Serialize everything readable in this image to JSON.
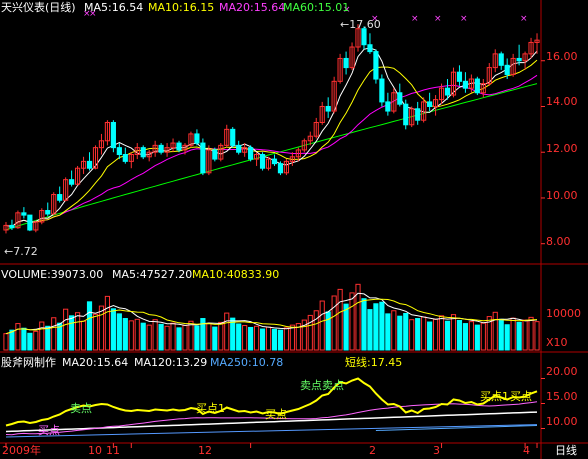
{
  "header": {
    "stock": "天兴仪表(日线)",
    "ma5": "MA5:16.54",
    "ma10": "MA10:16.15",
    "ma20": "MA20:15.64",
    "ma60": "MA60:15.01"
  },
  "annotations": {
    "high": "17.60",
    "low": "7.72"
  },
  "volume_header": {
    "volume": "VOLUME:39073.00",
    "ma5": "MA5:47527.20",
    "ma10": "MA10:40833.90"
  },
  "indicator_header": {
    "source": "股斧网制作",
    "ma20": "MA20:15.64",
    "ma120": "MA120:13.29",
    "ma250": "MA250:10.78",
    "short_line": "短线:17.45"
  },
  "signals": {
    "sell_1": "卖点",
    "buy_1": "买点1",
    "buy_2": "买点",
    "buy_3": "买点",
    "sell_2": "卖点卖点",
    "buy_4": "买点1",
    "buy_5": "买点"
  },
  "price_axis": [
    "16.00",
    "14.00",
    "12.00",
    "10.00",
    "8.00"
  ],
  "volume_axis": [
    "10000",
    "X10"
  ],
  "indicator_axis": [
    "20.00",
    "15.00",
    "10.00"
  ],
  "time_axis": [
    "2009年",
    "10",
    "11",
    "12",
    "2",
    "3",
    "4"
  ],
  "period": "日线",
  "colors": {
    "up": "#ff3030",
    "down": "#00ffff",
    "ma5": "#ffffff",
    "ma10": "#ffff00",
    "ma20": "#ff00ff",
    "ma60": "#00ff00",
    "axis": "#b00000"
  },
  "chart_data": {
    "type": "candlestick",
    "price_range": [
      7.2,
      18.0
    ],
    "high_marker": 17.6,
    "low_marker": 7.72,
    "ohlc": [
      [
        8.6,
        8.95,
        8.45,
        8.8
      ],
      [
        8.8,
        9.05,
        8.6,
        8.7
      ],
      [
        8.7,
        9.45,
        8.65,
        9.35
      ],
      [
        9.35,
        9.6,
        9.1,
        9.25
      ],
      [
        9.25,
        9.25,
        8.55,
        8.6
      ],
      [
        8.6,
        9.0,
        8.5,
        8.95
      ],
      [
        8.95,
        9.55,
        8.85,
        9.45
      ],
      [
        9.45,
        9.8,
        9.2,
        9.3
      ],
      [
        9.3,
        10.25,
        9.25,
        10.15
      ],
      [
        10.15,
        10.5,
        9.8,
        9.9
      ],
      [
        9.9,
        10.9,
        9.85,
        10.8
      ],
      [
        10.8,
        11.2,
        10.5,
        10.6
      ],
      [
        10.6,
        11.4,
        10.55,
        11.3
      ],
      [
        11.3,
        11.8,
        11.05,
        11.6
      ],
      [
        11.6,
        12.0,
        11.2,
        11.3
      ],
      [
        11.3,
        12.3,
        11.25,
        12.2
      ],
      [
        12.2,
        12.8,
        11.9,
        12.5
      ],
      [
        12.5,
        13.4,
        12.3,
        13.3
      ],
      [
        13.3,
        13.4,
        12.0,
        12.2
      ],
      [
        12.2,
        12.4,
        11.7,
        11.9
      ],
      [
        11.9,
        12.2,
        11.5,
        11.6
      ],
      [
        11.6,
        12.0,
        11.3,
        11.9
      ],
      [
        11.9,
        12.4,
        11.7,
        12.2
      ],
      [
        12.2,
        12.3,
        11.7,
        11.8
      ],
      [
        11.8,
        12.1,
        11.6,
        12.0
      ],
      [
        12.0,
        12.5,
        11.8,
        12.3
      ],
      [
        12.3,
        12.4,
        11.9,
        12.0
      ],
      [
        12.0,
        12.4,
        11.8,
        12.2
      ],
      [
        12.2,
        12.6,
        12.0,
        12.4
      ],
      [
        12.4,
        12.5,
        12.0,
        12.1
      ],
      [
        12.1,
        12.4,
        11.9,
        12.3
      ],
      [
        12.3,
        12.9,
        12.2,
        12.8
      ],
      [
        12.8,
        13.0,
        12.3,
        12.4
      ],
      [
        12.4,
        12.6,
        11.0,
        11.1
      ],
      [
        11.1,
        12.3,
        11.0,
        12.1
      ],
      [
        12.1,
        12.2,
        11.6,
        11.7
      ],
      [
        11.7,
        12.4,
        11.6,
        12.3
      ],
      [
        12.3,
        13.2,
        12.2,
        13.0
      ],
      [
        13.0,
        13.1,
        12.2,
        12.3
      ],
      [
        12.3,
        12.5,
        11.9,
        12.0
      ],
      [
        12.0,
        12.4,
        11.8,
        12.2
      ],
      [
        12.2,
        12.3,
        11.6,
        11.7
      ],
      [
        11.7,
        12.0,
        11.4,
        11.9
      ],
      [
        11.9,
        12.0,
        11.2,
        11.3
      ],
      [
        11.3,
        11.8,
        11.2,
        11.7
      ],
      [
        11.7,
        11.9,
        11.4,
        11.5
      ],
      [
        11.5,
        11.6,
        11.0,
        11.1
      ],
      [
        11.1,
        11.7,
        11.0,
        11.6
      ],
      [
        11.6,
        12.0,
        11.4,
        11.8
      ],
      [
        11.8,
        12.2,
        11.6,
        12.1
      ],
      [
        12.1,
        12.6,
        12.0,
        12.5
      ],
      [
        12.5,
        12.9,
        12.3,
        12.7
      ],
      [
        12.7,
        13.5,
        12.6,
        13.3
      ],
      [
        13.3,
        14.2,
        13.2,
        14.0
      ],
      [
        14.0,
        14.4,
        13.5,
        13.8
      ],
      [
        13.8,
        15.3,
        13.7,
        15.1
      ],
      [
        15.1,
        16.3,
        15.0,
        16.1
      ],
      [
        16.1,
        16.4,
        15.4,
        15.7
      ],
      [
        15.7,
        16.8,
        15.6,
        16.6
      ],
      [
        16.6,
        17.6,
        16.4,
        17.4
      ],
      [
        17.4,
        17.5,
        16.5,
        16.7
      ],
      [
        16.7,
        17.2,
        16.3,
        16.4
      ],
      [
        16.4,
        16.5,
        15.0,
        15.2
      ],
      [
        15.2,
        15.4,
        14.0,
        14.2
      ],
      [
        14.2,
        14.6,
        13.6,
        13.8
      ],
      [
        13.8,
        14.8,
        13.7,
        14.6
      ],
      [
        14.6,
        15.0,
        14.0,
        14.1
      ],
      [
        14.1,
        14.3,
        13.0,
        13.2
      ],
      [
        13.2,
        14.0,
        13.1,
        13.9
      ],
      [
        13.9,
        14.2,
        13.2,
        13.4
      ],
      [
        13.4,
        14.4,
        13.3,
        14.2
      ],
      [
        14.2,
        14.6,
        13.8,
        14.0
      ],
      [
        14.0,
        14.5,
        13.6,
        14.3
      ],
      [
        14.3,
        15.0,
        14.1,
        14.8
      ],
      [
        14.8,
        15.2,
        14.3,
        14.5
      ],
      [
        14.5,
        15.7,
        14.4,
        15.5
      ],
      [
        15.5,
        15.8,
        14.9,
        15.1
      ],
      [
        15.1,
        15.5,
        14.6,
        14.8
      ],
      [
        14.8,
        15.4,
        14.6,
        15.2
      ],
      [
        15.2,
        15.3,
        14.5,
        14.6
      ],
      [
        14.6,
        15.2,
        14.4,
        15.0
      ],
      [
        15.0,
        15.9,
        14.9,
        15.7
      ],
      [
        15.7,
        16.5,
        15.5,
        16.3
      ],
      [
        16.3,
        16.4,
        15.6,
        15.8
      ],
      [
        15.8,
        16.1,
        15.2,
        15.4
      ],
      [
        15.4,
        16.3,
        15.3,
        16.1
      ],
      [
        16.1,
        16.7,
        15.8,
        16.0
      ],
      [
        16.0,
        16.4,
        15.6,
        16.3
      ],
      [
        16.3,
        17.0,
        16.1,
        16.8
      ],
      [
        16.8,
        17.2,
        16.3,
        16.9
      ]
    ],
    "volume": [
      4200,
      5100,
      6800,
      5600,
      4300,
      4800,
      7200,
      6100,
      8300,
      6900,
      10500,
      8800,
      9600,
      7400,
      12400,
      9200,
      11300,
      13800,
      10600,
      9300,
      8100,
      7500,
      7900,
      6900,
      6400,
      7800,
      6600,
      6100,
      6900,
      5700,
      6300,
      7400,
      6200,
      8100,
      6800,
      5900,
      7100,
      9500,
      8200,
      6700,
      6300,
      5800,
      6100,
      5400,
      5900,
      5300,
      5100,
      5700,
      6400,
      6800,
      7700,
      8900,
      10100,
      12600,
      9800,
      13900,
      15600,
      11800,
      14700,
      16900,
      13200,
      10400,
      11900,
      12300,
      9300,
      10100,
      8700,
      9400,
      7800,
      8100,
      8500,
      7200,
      7900,
      8800,
      7400,
      9100,
      7600,
      6800,
      7300,
      6400,
      6900,
      8600,
      9700,
      7900,
      6500,
      8200,
      7100,
      7700,
      8400,
      7300
    ],
    "volume_range": [
      0,
      17500
    ],
    "short_line": [
      10.6,
      10.9,
      11.3,
      11.4,
      11.1,
      11.3,
      11.7,
      11.9,
      12.4,
      12.8,
      13.5,
      13.9,
      14.3,
      14.6,
      14.4,
      14.7,
      14.9,
      14.8,
      14.3,
      13.9,
      13.6,
      13.5,
      13.7,
      13.6,
      13.5,
      13.8,
      13.7,
      13.6,
      13.8,
      13.6,
      13.7,
      14.1,
      13.9,
      12.9,
      13.4,
      13.1,
      13.5,
      14.2,
      13.8,
      13.4,
      13.5,
      13.2,
      13.4,
      13.0,
      13.3,
      13.2,
      12.9,
      13.3,
      13.6,
      13.9,
      14.4,
      14.9,
      15.6,
      16.6,
      16.9,
      18.2,
      19.3,
      19.0,
      19.6,
      20.0,
      19.1,
      18.4,
      17.0,
      15.8,
      14.8,
      14.9,
      14.4,
      13.2,
      13.6,
      13.1,
      13.9,
      14.0,
      14.3,
      14.9,
      14.8,
      15.8,
      15.6,
      15.1,
      15.3,
      14.8,
      15.0,
      15.8,
      16.6,
      16.2,
      15.8,
      16.3,
      16.2,
      16.4,
      17.0,
      17.45
    ],
    "indicator_range": [
      7.5,
      22.5
    ]
  }
}
